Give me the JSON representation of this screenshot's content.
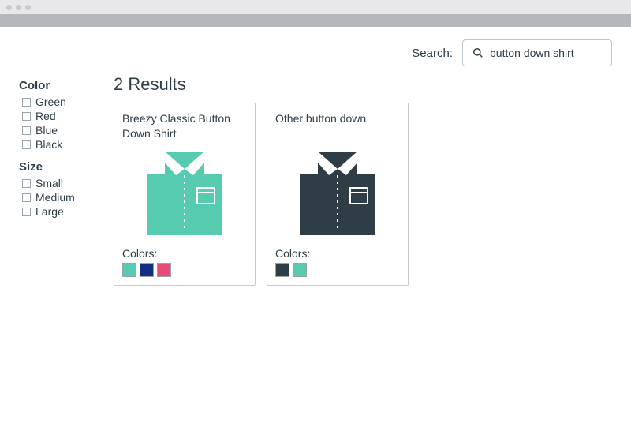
{
  "search": {
    "label": "Search:",
    "value": "button down shirt"
  },
  "sidebar": {
    "filters": [
      {
        "title": "Color",
        "options": [
          "Green",
          "Red",
          "Blue",
          "Black"
        ]
      },
      {
        "title": "Size",
        "options": [
          "Small",
          "Medium",
          "Large"
        ]
      }
    ]
  },
  "results": {
    "heading": "2 Results",
    "colors_label": "Colors:",
    "products": [
      {
        "title": "Breezy Classic Button Down Shirt",
        "shirt_color": "#57cbb0",
        "swatches": [
          "#57cbb0",
          "#102f82",
          "#e84a7a"
        ]
      },
      {
        "title": "Other button down",
        "shirt_color": "#2f3d46",
        "swatches": [
          "#2f3d46",
          "#57cbb0"
        ]
      }
    ]
  }
}
